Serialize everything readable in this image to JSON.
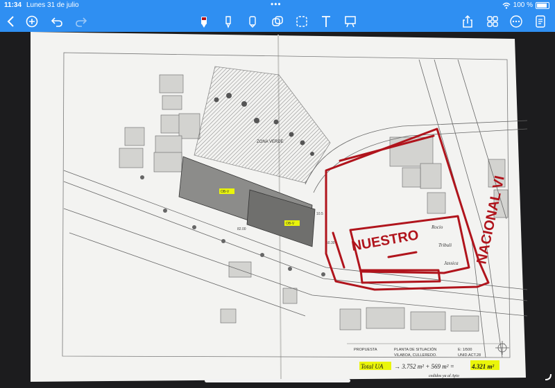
{
  "status": {
    "time": "11:34",
    "date": "Lunes 31 de julio",
    "battery": "100 %"
  },
  "toolbar": {
    "icons": [
      "back-icon",
      "add-icon",
      "undo-icon",
      "redo-icon",
      "pen-icon",
      "highlighter-icon",
      "pencil-icon",
      "eraser-icon",
      "lasso-icon",
      "text-tool-icon",
      "whiteboard-icon",
      "share-icon",
      "grid-icon",
      "more-icon",
      "notes-icon"
    ],
    "accent": "#2f8ff2"
  },
  "plan": {
    "zona_verde": "ZONA VERDE",
    "road_label": "NACIONAL VI",
    "parcel_label": "NUESTRO",
    "parcel_notes": [
      "Rocio",
      "Tribuli",
      "Jassica"
    ],
    "yellow_tags": [
      "OB-V",
      "OB-V"
    ],
    "small_labels": [
      "10.5",
      "82.00",
      "50.30"
    ],
    "title_block": {
      "label": "PROPUESTA",
      "line1": "PLANTA DE SITUACIÓN",
      "line2": "VILABOA, CULLEREDO.",
      "scale": "E: 1/500",
      "code": "UNID.ACT.28"
    },
    "handwritten": {
      "total": "Total UA",
      "formula": "→ 3.752 m² + 569 m² =",
      "result": "4.321 m²",
      "note": "cedidos ya al Ayto"
    }
  }
}
